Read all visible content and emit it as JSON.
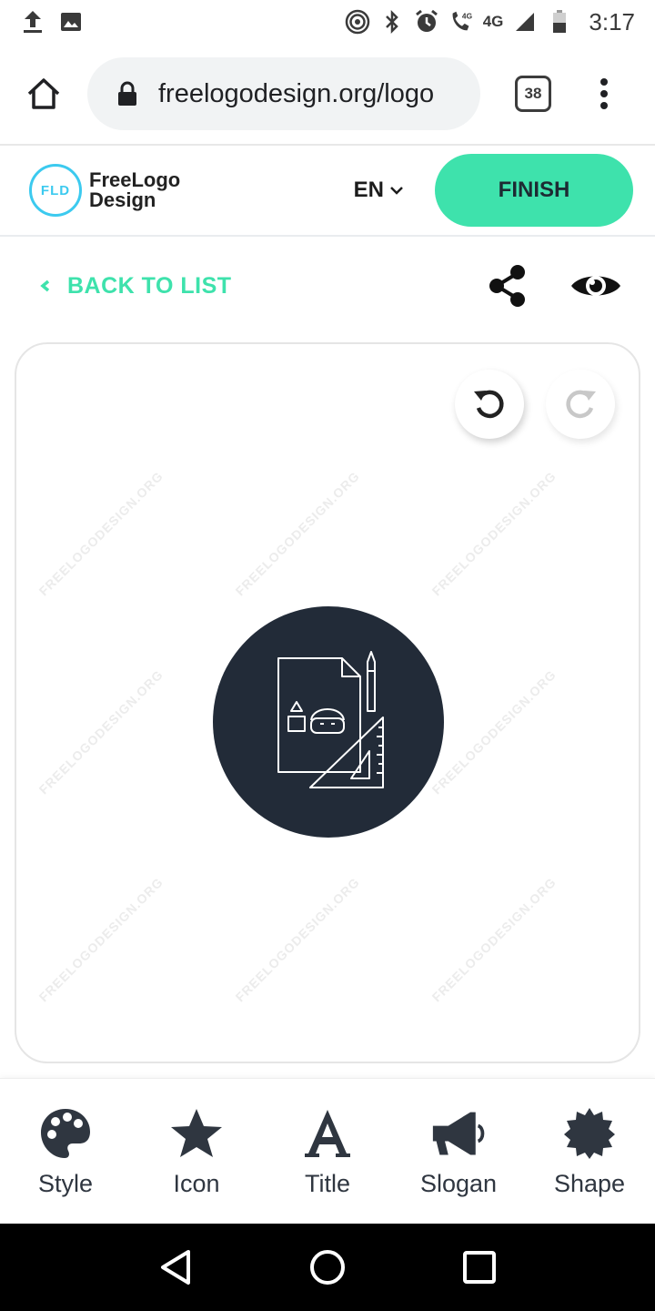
{
  "status_bar": {
    "network_label_small": "4G",
    "network_label": "4G",
    "time": "3:17"
  },
  "browser": {
    "url": "freelogodesign.org/logo",
    "tab_count": "38"
  },
  "site_header": {
    "logo_badge": "FLD",
    "logo_line1": "FreeLogo",
    "logo_line2": "Design",
    "language": "EN",
    "finish_label": "FINISH"
  },
  "toolbar": {
    "back_label": "BACK TO LIST"
  },
  "canvas": {
    "watermark": "FREELOGODESIGN.ORG",
    "logo_circle_color": "#222b38"
  },
  "bottom_nav": {
    "items": [
      {
        "label": "Style",
        "icon": "palette-icon"
      },
      {
        "label": "Icon",
        "icon": "star-icon"
      },
      {
        "label": "Title",
        "icon": "letter-a-icon"
      },
      {
        "label": "Slogan",
        "icon": "megaphone-icon"
      },
      {
        "label": "Shape",
        "icon": "badge-icon"
      }
    ]
  },
  "colors": {
    "accent": "#3ee2ac",
    "logo_blue": "#3ccaef",
    "dark": "#222b38"
  }
}
